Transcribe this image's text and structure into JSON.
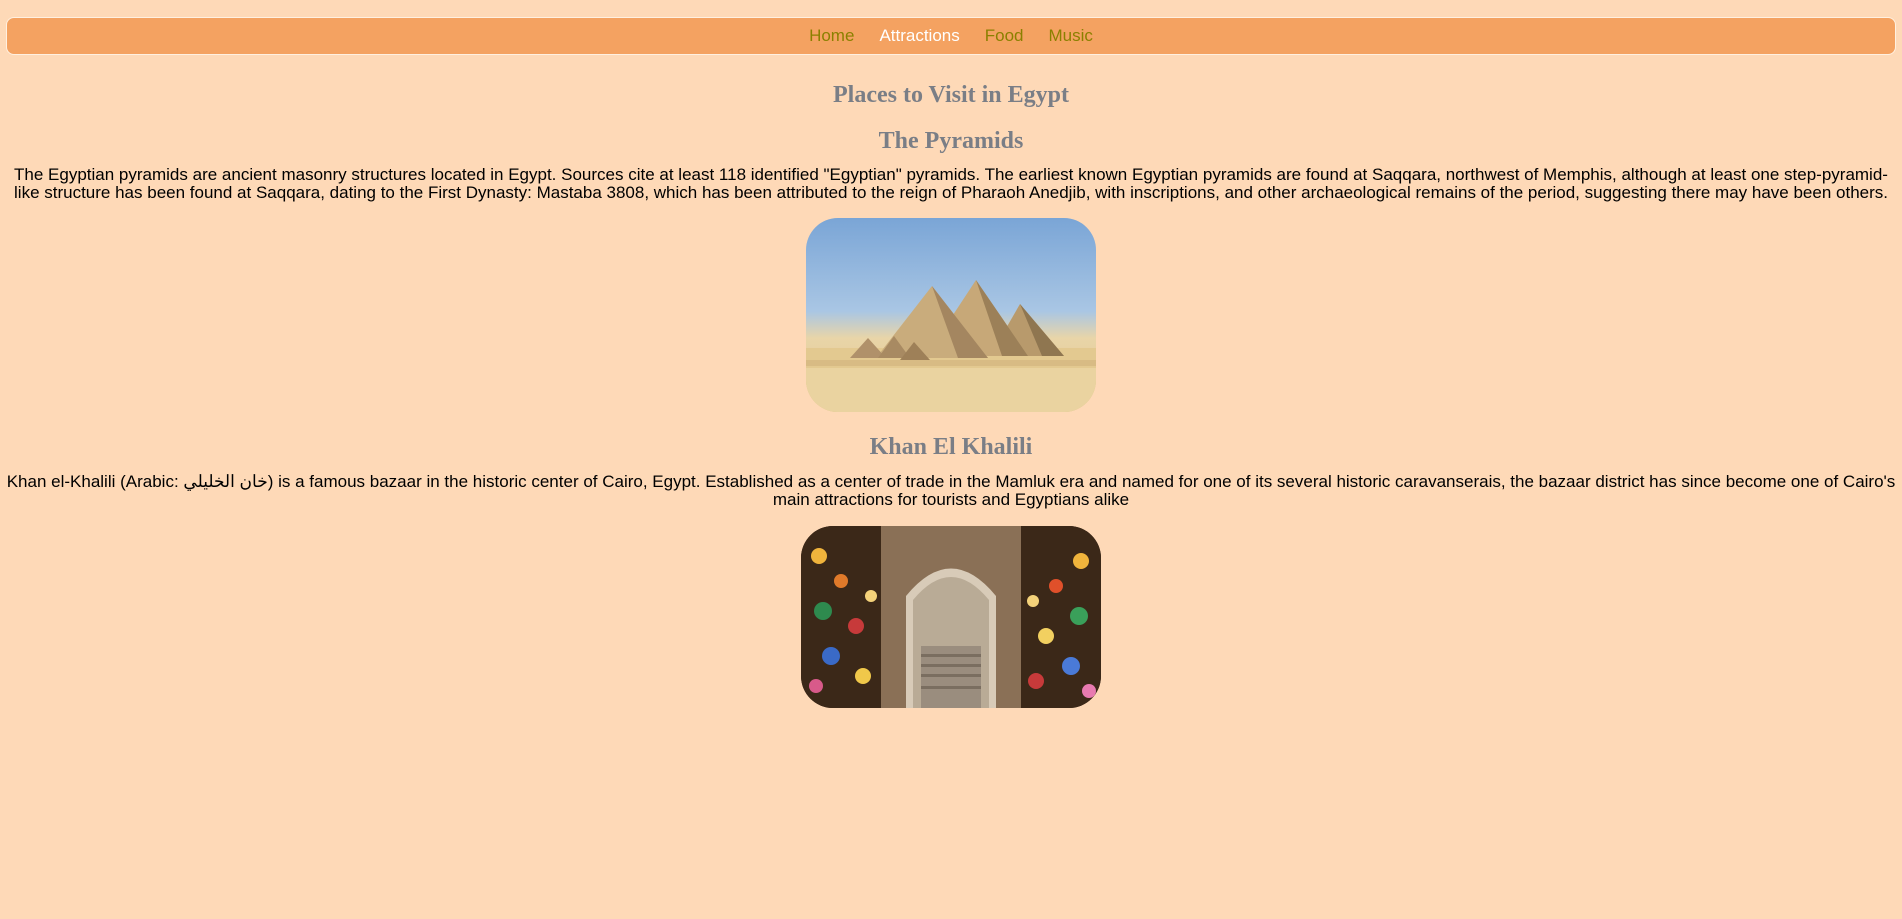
{
  "nav": {
    "items": [
      {
        "label": "Home",
        "active": false
      },
      {
        "label": "Attractions",
        "active": true
      },
      {
        "label": "Food",
        "active": false
      },
      {
        "label": "Music",
        "active": false
      }
    ]
  },
  "page": {
    "title": "Places to Visit in Egypt"
  },
  "sections": [
    {
      "title": "The Pyramids",
      "text": "The Egyptian pyramids are ancient masonry structures located in Egypt. Sources cite at least 118 identified \"Egyptian\" pyramids. The earliest known Egyptian pyramids are found at Saqqara, northwest of Memphis, although at least one step-pyramid-like structure has been found at Saqqara, dating to the First Dynasty: Mastaba 3808, which has been attributed to the reign of Pharaoh Anedjib, with inscriptions, and other archaeological remains of the period, suggesting there may have been others."
    },
    {
      "title": "Khan El Khalili",
      "text": "Khan el-Khalili (Arabic: خان الخليلي) is a famous bazaar in the historic center of Cairo, Egypt. Established as a center of trade in the Mamluk era and named for one of its several historic caravanserais, the bazaar district has since become one of Cairo's main attractions for tourists and Egyptians alike"
    }
  ],
  "colors": {
    "background": "#fed9b7",
    "navbar": "#f4a261",
    "nav_link": "#8b8000",
    "nav_link_active": "#ffffff",
    "heading": "#7a7e86"
  }
}
